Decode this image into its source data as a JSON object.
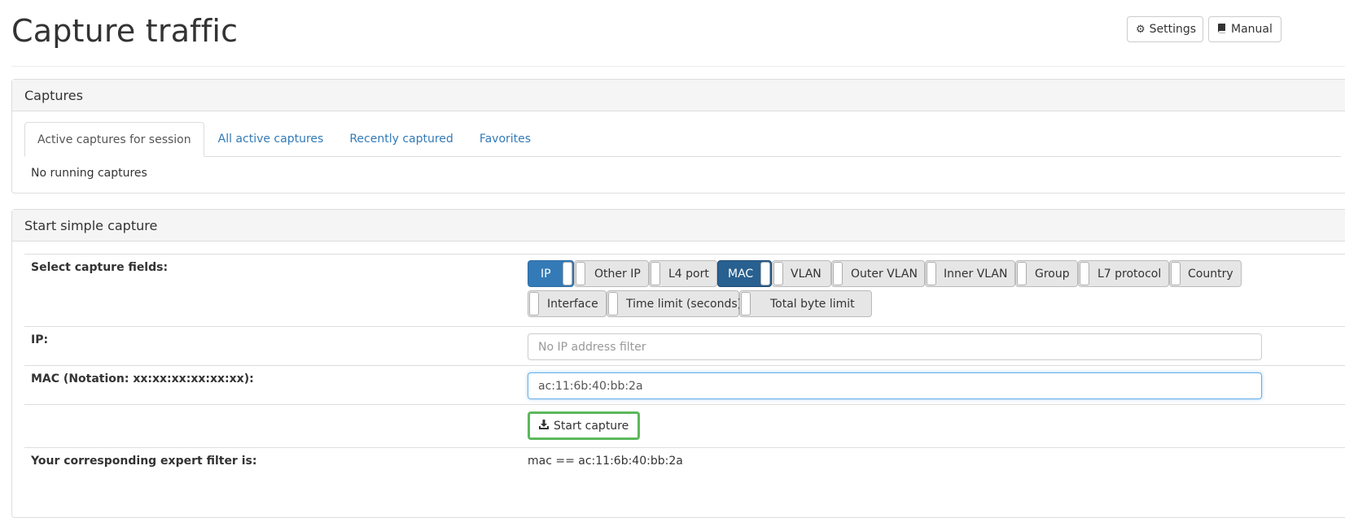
{
  "header": {
    "title": "Capture traffic",
    "settings_label": "Settings",
    "manual_label": "Manual"
  },
  "captures_panel": {
    "heading": "Captures",
    "tabs": [
      {
        "label": "Active captures for session",
        "active": true
      },
      {
        "label": "All active captures",
        "active": false
      },
      {
        "label": "Recently captured",
        "active": false
      },
      {
        "label": "Favorites",
        "active": false
      }
    ],
    "empty_text": "No running captures"
  },
  "simple_capture": {
    "heading": "Start simple capture",
    "fields_label": "Select capture fields:",
    "fields": [
      {
        "label": "IP",
        "on": true
      },
      {
        "label": "Other IP",
        "on": false
      },
      {
        "label": "L4 port",
        "on": false
      },
      {
        "label": "MAC",
        "on": true
      },
      {
        "label": "VLAN",
        "on": false
      },
      {
        "label": "Outer VLAN",
        "on": false
      },
      {
        "label": "Inner VLAN",
        "on": false
      },
      {
        "label": "Group",
        "on": false
      },
      {
        "label": "L7 protocol",
        "on": false
      },
      {
        "label": "Country",
        "on": false
      },
      {
        "label": "Interface",
        "on": false
      },
      {
        "label": "Time limit (seconds)",
        "on": false
      },
      {
        "label": "Total byte limit",
        "on": false
      }
    ],
    "ip_label": "IP:",
    "ip_placeholder": "No IP address filter",
    "ip_value": "",
    "mac_label": "MAC (Notation: xx:xx:xx:xx:xx:xx):",
    "mac_value": "ac:11:6b:40:bb:2a",
    "start_label": "Start capture",
    "expert_label": "Your corresponding expert filter is:",
    "expert_value": "mac == ac:11:6b:40:bb:2a"
  },
  "colors": {
    "primary": "#337ab7",
    "primary_dark": "#286090",
    "success_border": "#5cb85c",
    "link": "#337ab7"
  }
}
